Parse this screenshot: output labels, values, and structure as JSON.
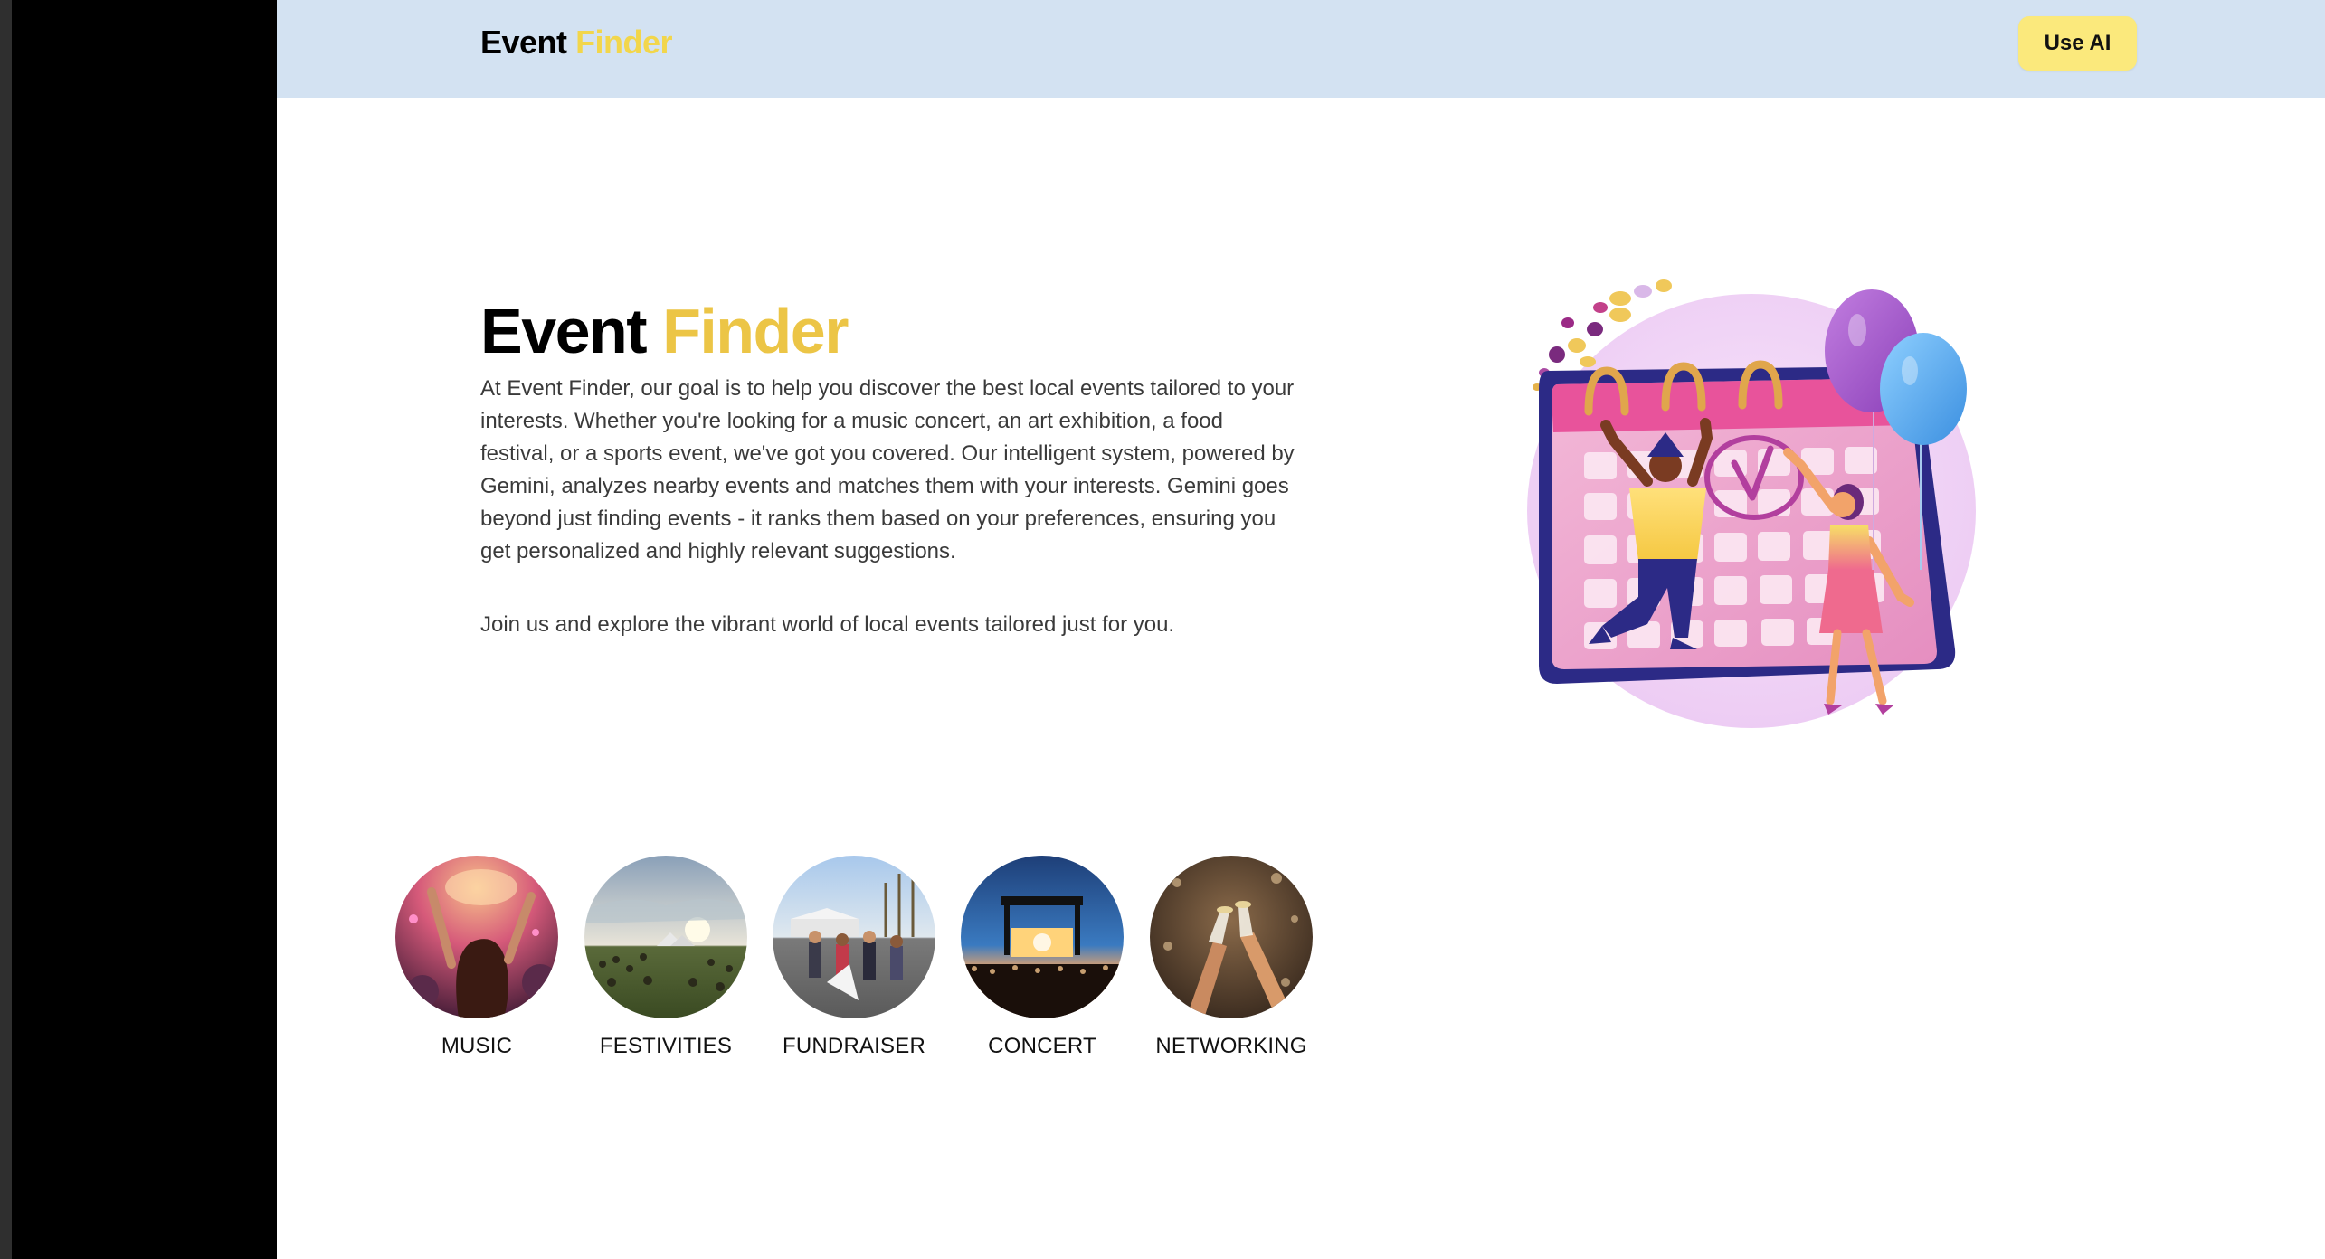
{
  "header": {
    "logo_word_1": "Event",
    "logo_word_2": "Finder",
    "use_ai_label": "Use AI"
  },
  "hero": {
    "title_word_1": "Event",
    "title_word_2": "Finder",
    "description": "At Event Finder, our goal is to help you discover the best local events tailored to your interests. Whether you're looking for a music concert, an art exhibition, a food festival, or a sports event, we've got you covered. Our intelligent system, powered by Gemini, analyzes nearby events and matches them with your interests. Gemini goes beyond just finding events - it ranks them based on your preferences, ensuring you get personalized and highly relevant suggestions.",
    "invite": "Join us and explore the vibrant world of local events tailored just for you."
  },
  "categories": [
    {
      "label": "MUSIC"
    },
    {
      "label": "FESTIVITIES"
    },
    {
      "label": "FUNDRAISER"
    },
    {
      "label": "CONCERT"
    },
    {
      "label": "NETWORKING"
    }
  ],
  "colors": {
    "header_bg": "#d3e2f2",
    "accent_yellow": "#ecc546",
    "button_bg": "#fbe97c",
    "left_rail": "#000000",
    "body_text": "#3a3a3a"
  },
  "icons": {
    "hero_illustration": "calendar-celebration-illustration"
  }
}
